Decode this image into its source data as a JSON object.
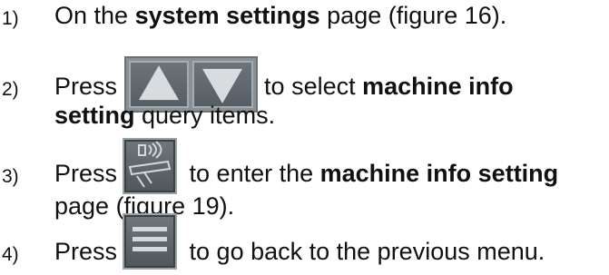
{
  "steps": [
    {
      "number": "1)",
      "pre": "On the ",
      "bold": "system settings",
      "post": " page (figure 16)."
    },
    {
      "number": "2)",
      "pre": "Press",
      "icon": "up-down-arrows-icon",
      "mid": " to select ",
      "bold": "machine info",
      "bold2": "setting",
      "post": " query items."
    },
    {
      "number": "3)",
      "pre": "Press",
      "icon": "machine-info-icon",
      "mid": " to enter the ",
      "bold": "machine info setting",
      "post": "page (figure 19)."
    },
    {
      "number": "4)",
      "pre": "Press",
      "icon": "menu-icon",
      "post": " to go back to the previous menu."
    }
  ],
  "colors": {
    "text": "#111111",
    "button_face": "#5f676c",
    "button_border": "#9aa3a8",
    "glyph": "#d9dcde"
  }
}
